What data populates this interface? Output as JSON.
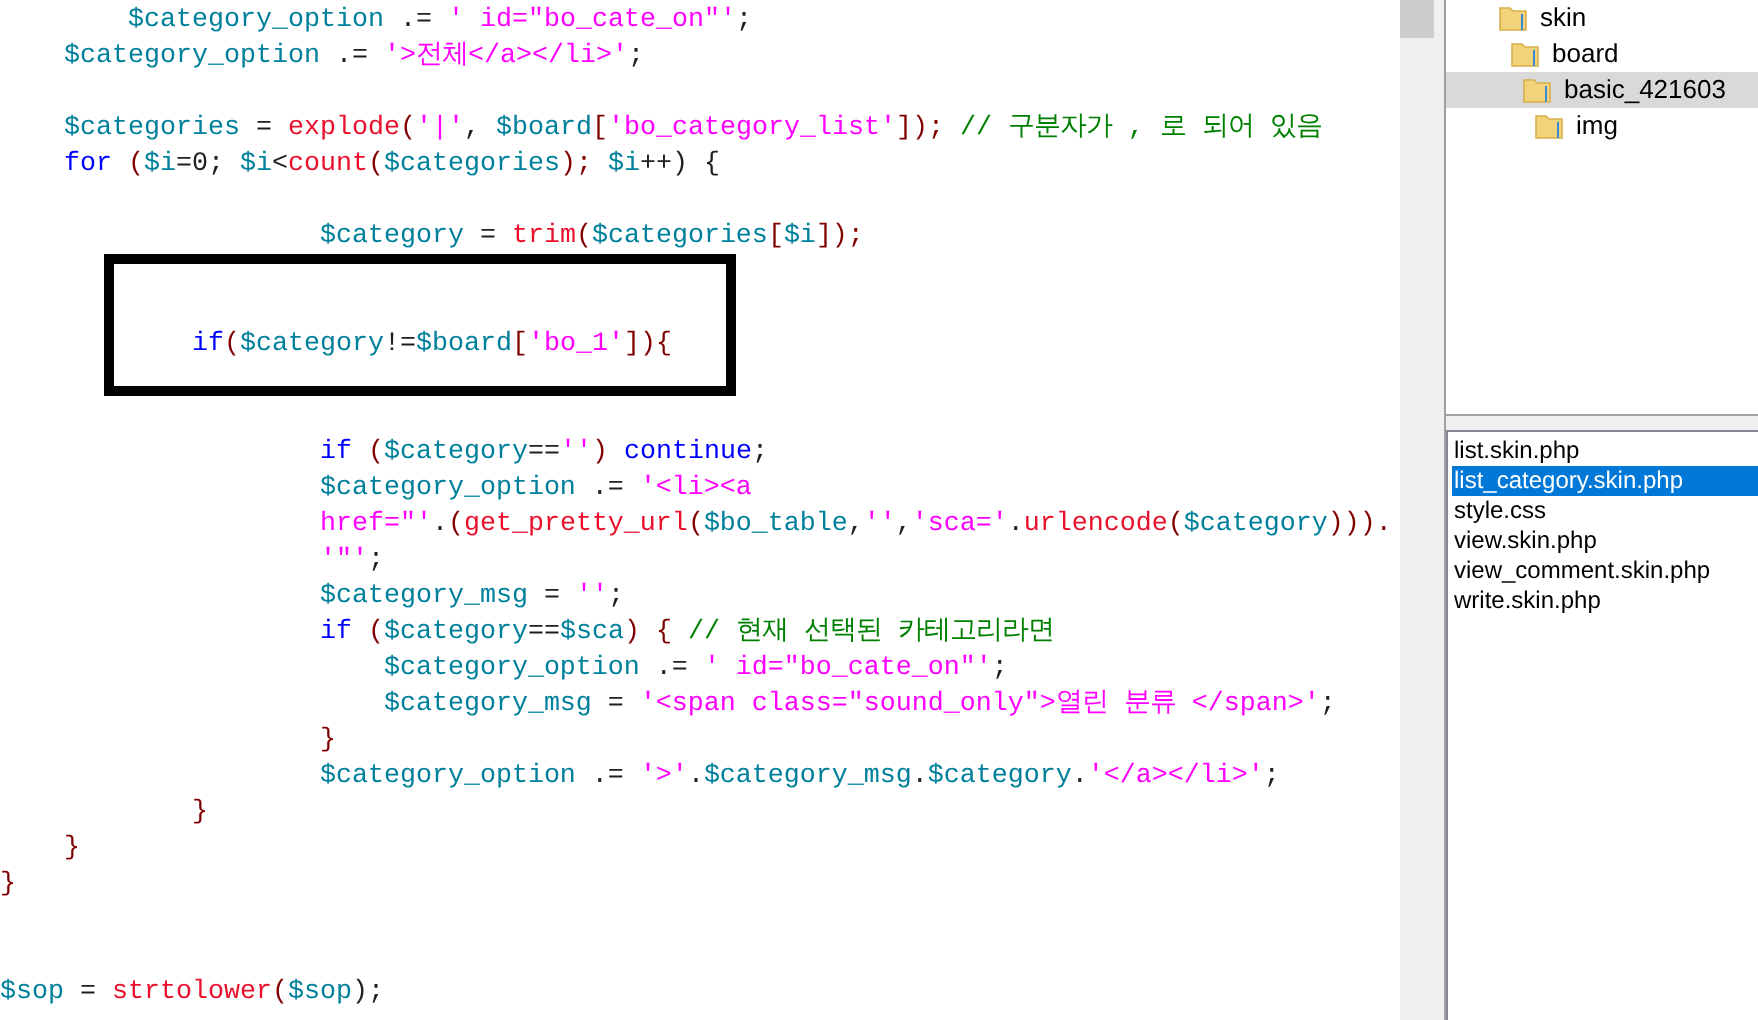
{
  "editor": {
    "lines": [
      {
        "kind": "code",
        "tokens": [
          {
            "kind": "var",
            "text": "        $category_option"
          },
          {
            "kind": "op",
            "text": " .= "
          },
          {
            "kind": "str",
            "text": "' id=\"bo_cate_on\"'"
          },
          {
            "kind": "op",
            "text": ";"
          }
        ]
      },
      {
        "kind": "code",
        "tokens": [
          {
            "kind": "var",
            "text": "    $category_option"
          },
          {
            "kind": "op",
            "text": " .= "
          },
          {
            "kind": "str",
            "text": "'>전체</a></li>'"
          },
          {
            "kind": "op",
            "text": ";"
          }
        ]
      },
      {
        "kind": "blank"
      },
      {
        "kind": "code",
        "tokens": [
          {
            "kind": "var",
            "text": "    $categories"
          },
          {
            "kind": "op",
            "text": " = "
          },
          {
            "kind": "fn",
            "text": "explode"
          },
          {
            "kind": "br",
            "text": "("
          },
          {
            "kind": "str",
            "text": "'|'"
          },
          {
            "kind": "op",
            "text": ", "
          },
          {
            "kind": "var",
            "text": "$board"
          },
          {
            "kind": "br",
            "text": "["
          },
          {
            "kind": "str",
            "text": "'bo_category_list'"
          },
          {
            "kind": "br",
            "text": "]);"
          },
          {
            "kind": "cmt",
            "text": " // 구분자가 , 로 되어 있음"
          }
        ]
      },
      {
        "kind": "code",
        "tokens": [
          {
            "kind": "kw",
            "text": "    for"
          },
          {
            "kind": "br",
            "text": " ("
          },
          {
            "kind": "var",
            "text": "$i"
          },
          {
            "kind": "op",
            "text": "=0; "
          },
          {
            "kind": "var",
            "text": "$i"
          },
          {
            "kind": "op",
            "text": "<"
          },
          {
            "kind": "fn",
            "text": "count"
          },
          {
            "kind": "br",
            "text": "("
          },
          {
            "kind": "var",
            "text": "$categories"
          },
          {
            "kind": "br",
            "text": "); "
          },
          {
            "kind": "var",
            "text": "$i"
          },
          {
            "kind": "op",
            "text": "++) {"
          }
        ]
      },
      {
        "kind": "blank"
      },
      {
        "kind": "code",
        "tokens": [
          {
            "kind": "var",
            "text": "                    $category"
          },
          {
            "kind": "op",
            "text": " = "
          },
          {
            "kind": "fn",
            "text": "trim"
          },
          {
            "kind": "br",
            "text": "("
          },
          {
            "kind": "var",
            "text": "$categories"
          },
          {
            "kind": "br",
            "text": "["
          },
          {
            "kind": "var",
            "text": "$i"
          },
          {
            "kind": "br",
            "text": "]);"
          }
        ]
      },
      {
        "kind": "blank"
      },
      {
        "kind": "blank"
      },
      {
        "kind": "code",
        "tokens": [
          {
            "kind": "kw",
            "text": "            if"
          },
          {
            "kind": "br",
            "text": "("
          },
          {
            "kind": "var",
            "text": "$category"
          },
          {
            "kind": "op",
            "text": "!="
          },
          {
            "kind": "var",
            "text": "$board"
          },
          {
            "kind": "br",
            "text": "["
          },
          {
            "kind": "str",
            "text": "'bo_1'"
          },
          {
            "kind": "br",
            "text": "]){"
          }
        ]
      },
      {
        "kind": "blank"
      },
      {
        "kind": "blank"
      },
      {
        "kind": "code",
        "tokens": [
          {
            "kind": "kw",
            "text": "                    if"
          },
          {
            "kind": "br",
            "text": " ("
          },
          {
            "kind": "var",
            "text": "$category"
          },
          {
            "kind": "op",
            "text": "=="
          },
          {
            "kind": "str",
            "text": "''"
          },
          {
            "kind": "br",
            "text": ") "
          },
          {
            "kind": "kw",
            "text": "continue"
          },
          {
            "kind": "op",
            "text": ";"
          }
        ]
      },
      {
        "kind": "code",
        "tokens": [
          {
            "kind": "var",
            "text": "                    $category_option"
          },
          {
            "kind": "op",
            "text": " .= "
          },
          {
            "kind": "str",
            "text": "'<li><a"
          }
        ]
      },
      {
        "kind": "code",
        "tokens": [
          {
            "kind": "str",
            "text": "                    href=\"'"
          },
          {
            "kind": "op",
            "text": "."
          },
          {
            "kind": "br",
            "text": "("
          },
          {
            "kind": "fn",
            "text": "get_pretty_url"
          },
          {
            "kind": "br",
            "text": "("
          },
          {
            "kind": "var",
            "text": "$bo_table"
          },
          {
            "kind": "op",
            "text": ","
          },
          {
            "kind": "str",
            "text": "''"
          },
          {
            "kind": "op",
            "text": ","
          },
          {
            "kind": "str",
            "text": "'sca='"
          },
          {
            "kind": "op",
            "text": "."
          },
          {
            "kind": "fn",
            "text": "urlencode"
          },
          {
            "kind": "br",
            "text": "("
          },
          {
            "kind": "var",
            "text": "$category"
          },
          {
            "kind": "br",
            "text": ")))."
          }
        ]
      },
      {
        "kind": "code",
        "tokens": [
          {
            "kind": "str",
            "text": "                    '\"'"
          },
          {
            "kind": "op",
            "text": ";"
          }
        ]
      },
      {
        "kind": "code",
        "tokens": [
          {
            "kind": "var",
            "text": "                    $category_msg"
          },
          {
            "kind": "op",
            "text": " = "
          },
          {
            "kind": "str",
            "text": "''"
          },
          {
            "kind": "op",
            "text": ";"
          }
        ]
      },
      {
        "kind": "code",
        "tokens": [
          {
            "kind": "kw",
            "text": "                    if"
          },
          {
            "kind": "br",
            "text": " ("
          },
          {
            "kind": "var",
            "text": "$category"
          },
          {
            "kind": "op",
            "text": "=="
          },
          {
            "kind": "var",
            "text": "$sca"
          },
          {
            "kind": "br",
            "text": ") { "
          },
          {
            "kind": "cmt",
            "text": "// 현재 선택된 카테고리라면"
          }
        ]
      },
      {
        "kind": "code",
        "tokens": [
          {
            "kind": "var",
            "text": "                        $category_option"
          },
          {
            "kind": "op",
            "text": " .= "
          },
          {
            "kind": "str",
            "text": "' id=\"bo_cate_on\"'"
          },
          {
            "kind": "op",
            "text": ";"
          }
        ]
      },
      {
        "kind": "code",
        "tokens": [
          {
            "kind": "var",
            "text": "                        $category_msg"
          },
          {
            "kind": "op",
            "text": " = "
          },
          {
            "kind": "str",
            "text": "'<span class=\"sound_only\">열린 분류 </span>'"
          },
          {
            "kind": "op",
            "text": ";"
          }
        ]
      },
      {
        "kind": "code",
        "tokens": [
          {
            "kind": "br",
            "text": "                    }"
          }
        ]
      },
      {
        "kind": "code",
        "tokens": [
          {
            "kind": "var",
            "text": "                    $category_option"
          },
          {
            "kind": "op",
            "text": " .= "
          },
          {
            "kind": "str",
            "text": "'>'"
          },
          {
            "kind": "op",
            "text": "."
          },
          {
            "kind": "var",
            "text": "$category_msg"
          },
          {
            "kind": "op",
            "text": "."
          },
          {
            "kind": "var",
            "text": "$category"
          },
          {
            "kind": "op",
            "text": "."
          },
          {
            "kind": "str",
            "text": "'</a></li>'"
          },
          {
            "kind": "op",
            "text": ";"
          }
        ]
      },
      {
        "kind": "code",
        "tokens": [
          {
            "kind": "br",
            "text": "            }"
          }
        ]
      },
      {
        "kind": "code",
        "tokens": [
          {
            "kind": "br",
            "text": "    }"
          }
        ]
      },
      {
        "kind": "code",
        "tokens": [
          {
            "kind": "br",
            "text": "}"
          }
        ]
      },
      {
        "kind": "blank"
      },
      {
        "kind": "blank"
      },
      {
        "kind": "code",
        "tokens": [
          {
            "kind": "var",
            "text": "$sop"
          },
          {
            "kind": "op",
            "text": " = "
          },
          {
            "kind": "fn",
            "text": "strtolower"
          },
          {
            "kind": "br",
            "text": "("
          },
          {
            "kind": "var",
            "text": "$sop"
          },
          {
            "kind": "op",
            "text": ");"
          }
        ]
      }
    ]
  },
  "folder_tree": [
    {
      "label": "skin",
      "selected": false,
      "children": [
        {
          "label": "board",
          "selected": false,
          "children": [
            {
              "label": "basic_421603",
              "selected": true,
              "children": [
                {
                  "label": "img",
                  "selected": false
                }
              ]
            }
          ]
        }
      ]
    }
  ],
  "file_list": [
    {
      "label": "list.skin.php",
      "selected": false
    },
    {
      "label": "list_category.skin.php",
      "selected": true
    },
    {
      "label": "style.css",
      "selected": false
    },
    {
      "label": "view.skin.php",
      "selected": false
    },
    {
      "label": "view_comment.skin.php",
      "selected": false
    },
    {
      "label": "write.skin.php",
      "selected": false
    }
  ]
}
